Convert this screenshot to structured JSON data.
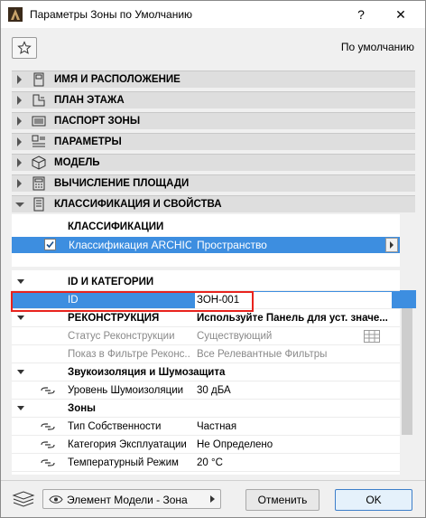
{
  "window": {
    "title": "Параметры Зоны по Умолчанию",
    "help": "?",
    "close": "✕"
  },
  "header": {
    "default_label": "По умолчанию"
  },
  "panels": [
    {
      "label": "ИМЯ И РАСПОЛОЖЕНИЕ",
      "icon": "name-location-icon"
    },
    {
      "label": "ПЛАН ЭТАЖА",
      "icon": "floor-plan-icon"
    },
    {
      "label": "ПАСПОРТ ЗОНЫ",
      "icon": "zone-stamp-icon"
    },
    {
      "label": "ПАРАМЕТРЫ",
      "icon": "parameters-icon"
    },
    {
      "label": "МОДЕЛЬ",
      "icon": "model-cube-icon"
    },
    {
      "label": "ВЫЧИСЛЕНИЕ ПЛОЩАДИ",
      "icon": "area-calc-icon"
    },
    {
      "label": "КЛАССИФИКАЦИЯ И СВОЙСТВА",
      "icon": "classification-icon"
    }
  ],
  "classification": {
    "header": "КЛАССИФИКАЦИИ",
    "row": {
      "checked": true,
      "name": "Классификация ARCHIC...",
      "value": "Пространство"
    }
  },
  "properties": [
    {
      "type": "group",
      "key": "ID И КАТЕГОРИИ",
      "value": ""
    },
    {
      "type": "selected",
      "key": "ID",
      "value": "ЗОН-001"
    },
    {
      "type": "group",
      "key": "РЕКОНСТРУКЦИЯ",
      "value": "Используйте Панель для уст. значе..."
    },
    {
      "type": "grey",
      "key": "Статус Реконструкции",
      "value": "Существующий"
    },
    {
      "type": "grey",
      "key": "Показ в Фильтре Реконс...",
      "value": "Все Релевантные Фильтры"
    },
    {
      "type": "subgroup",
      "key": "Звукоизоляция и Шумозащита",
      "value": ""
    },
    {
      "type": "item",
      "key": "Уровень Шумоизоляции",
      "value": "30 дБА"
    },
    {
      "type": "subgroup",
      "key": "Зоны",
      "value": ""
    },
    {
      "type": "item",
      "key": "Тип Собственности",
      "value": "Частная"
    },
    {
      "type": "item",
      "key": "Категория Эксплуатации",
      "value": "Не Определено"
    },
    {
      "type": "item",
      "key": "Температурный Режим",
      "value": "20 °С"
    }
  ],
  "footer": {
    "model_view": "Элемент Модели - Зона",
    "cancel": "Отменить",
    "ok": "OK"
  },
  "colors": {
    "selection": "#3d8ee0",
    "highlight_frame": "#e8231d"
  }
}
